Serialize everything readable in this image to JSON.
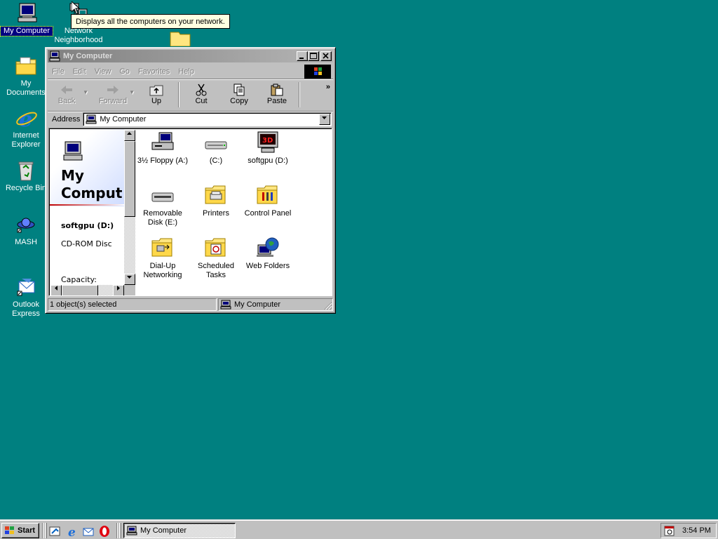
{
  "desktop": {
    "background": "#008080",
    "icons": [
      {
        "label": "My Computer",
        "icon": "my-computer-icon",
        "selected": true
      },
      {
        "label": "Network Neighborhood",
        "icon": "network-neighborhood-icon"
      },
      {
        "label": "My Documents",
        "icon": "my-documents-icon"
      },
      {
        "label": "Internet Explorer",
        "icon": "internet-explorer-icon"
      },
      {
        "label": "Recycle Bin",
        "icon": "recycle-bin-icon"
      },
      {
        "label": "MASH",
        "icon": "mash-icon"
      },
      {
        "label": "Outlook Express",
        "icon": "outlook-express-icon"
      }
    ]
  },
  "tooltip": {
    "text": "Displays all the computers on your network."
  },
  "window": {
    "title": "My Computer",
    "buttons": {
      "minimize": "_",
      "maximize": "□",
      "close": "×"
    },
    "menu": [
      "File",
      "Edit",
      "View",
      "Go",
      "Favorites",
      "Help"
    ],
    "toolbar": {
      "back": "Back",
      "forward": "Forward",
      "up": "Up",
      "cut": "Cut",
      "copy": "Copy",
      "paste": "Paste",
      "more": "»"
    },
    "address": {
      "label": "Address",
      "value": "My Computer"
    },
    "left_pane": {
      "heading": "My Comput",
      "selected_name": "softgpu (D:)",
      "selected_type": "CD-ROM Disc",
      "capacity_label": "Capacity:"
    },
    "items": [
      {
        "label": "3½ Floppy (A:)",
        "icon": "floppy-drive-icon"
      },
      {
        "label": "(C:)",
        "icon": "hard-drive-icon"
      },
      {
        "label": "softgpu (D:)",
        "icon": "cdrom-drive-icon"
      },
      {
        "label": "Removable Disk (E:)",
        "icon": "removable-disk-icon"
      },
      {
        "label": "Printers",
        "icon": "printers-folder-icon"
      },
      {
        "label": "Control Panel",
        "icon": "control-panel-folder-icon"
      },
      {
        "label": "Dial-Up Networking",
        "icon": "dialup-networking-folder-icon"
      },
      {
        "label": "Scheduled Tasks",
        "icon": "scheduled-tasks-folder-icon"
      },
      {
        "label": "Web Folders",
        "icon": "web-folders-icon"
      }
    ],
    "status": {
      "selection": "1 object(s) selected",
      "location": "My Computer"
    }
  },
  "taskbar": {
    "start_label": "Start",
    "quick_launch": [
      "show-desktop-icon",
      "internet-explorer-icon",
      "outlook-express-icon",
      "opera-icon"
    ],
    "tasks": [
      {
        "label": "My Computer",
        "icon": "my-computer-icon"
      }
    ],
    "clock": "3:54 PM",
    "tray": [
      "scheduler-tray-icon"
    ]
  }
}
